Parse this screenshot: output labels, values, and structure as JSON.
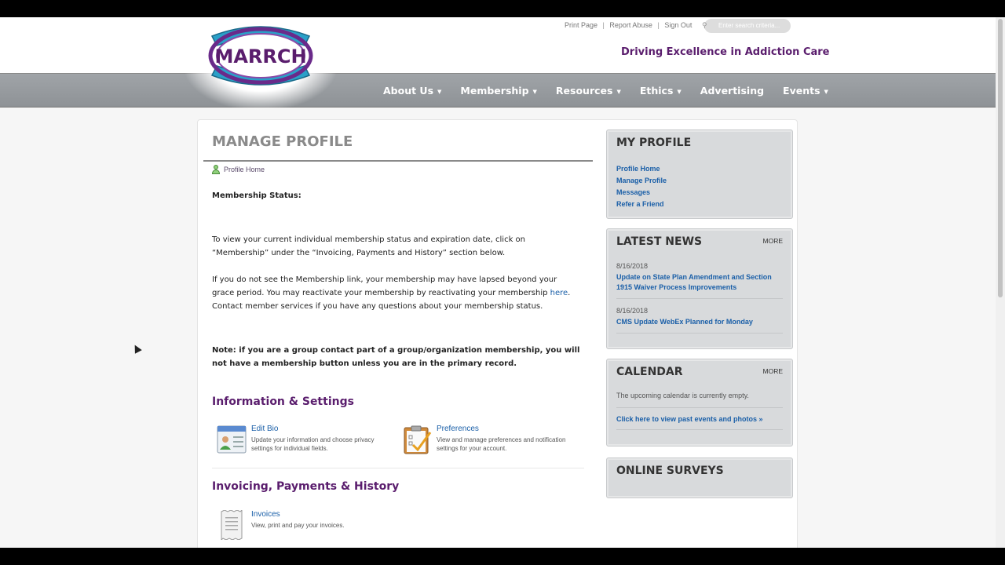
{
  "header": {
    "util_links": [
      "Print Page",
      "Report Abuse",
      "Sign Out"
    ],
    "search_placeholder": "Enter search criteria...",
    "tagline": "Driving Excellence in Addiction Care",
    "logo_text": "MARRCH"
  },
  "nav": {
    "items": [
      {
        "label": "About Us",
        "dropdown": true
      },
      {
        "label": "Membership",
        "dropdown": true
      },
      {
        "label": "Resources",
        "dropdown": true
      },
      {
        "label": "Ethics",
        "dropdown": true
      },
      {
        "label": "Advertising",
        "dropdown": false
      },
      {
        "label": "Events",
        "dropdown": true
      }
    ]
  },
  "main": {
    "title": "MANAGE PROFILE",
    "profile_home": "Profile Home",
    "membership_status_label": "Membership Status:",
    "para1": "To view your current individual membership status and expiration date, click on “Membership” under the “Invoicing, Payments and History” section below.",
    "para2_before": "If you do not see the Membership link, your membership may have lapsed beyond your grace period. You may reactivate your membership by reactivating your membership ",
    "para2_link": "here",
    "para2_after": ". Contact member services if you have any questions about your membership status.",
    "note": "Note:  if you are a group contact part of a group/organization membership, you will not have a membership button unless you are in the primary record.",
    "section1_title": "Information & Settings",
    "edit_bio_title": "Edit Bio",
    "edit_bio_desc": "Update your information and choose privacy settings for individual fields.",
    "preferences_title": "Preferences",
    "preferences_desc": "View and manage preferences and notification settings for your account.",
    "section2_title": "Invoicing, Payments & History",
    "invoices_title": "Invoices",
    "invoices_desc": "View, print and pay your invoices."
  },
  "sidebar": {
    "my_profile": {
      "title": "MY PROFILE",
      "links": [
        "Profile Home",
        "Manage Profile",
        "Messages",
        "Refer a Friend"
      ]
    },
    "latest_news": {
      "title": "LATEST NEWS",
      "more": "MORE",
      "items": [
        {
          "date": "8/16/2018",
          "title": "Update on State Plan Amendment and Section 1915 Waiver Process Improvements"
        },
        {
          "date": "8/16/2018",
          "title": "CMS Update WebEx Planned for Monday"
        }
      ]
    },
    "calendar": {
      "title": "CALENDAR",
      "more": "MORE",
      "empty_text": "The upcoming calendar is currently empty.",
      "past_link": "Click here to view past events and photos »"
    },
    "online_surveys": {
      "title": "ONLINE SURVEYS"
    }
  }
}
